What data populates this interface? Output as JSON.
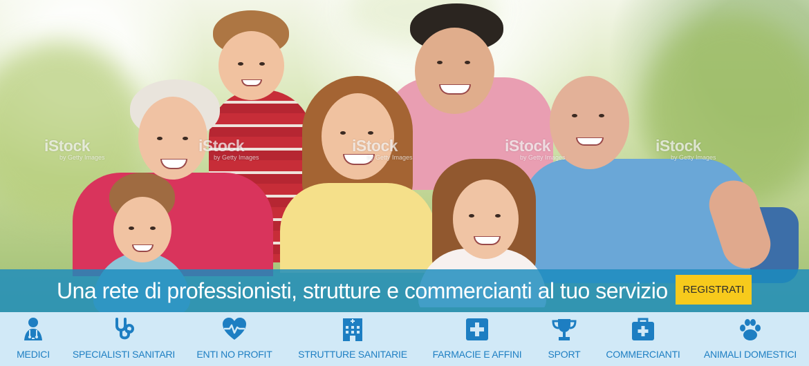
{
  "hero": {
    "watermark": {
      "brand": "iStock",
      "credit": "by Getty Images"
    }
  },
  "banner": {
    "title": "Una rete di professionisti, strutture e commercianti al tuo servizio",
    "register_label": "REGISTRATI"
  },
  "categories": [
    {
      "label": "MEDICI",
      "icon": "doctor-icon"
    },
    {
      "label": "SPECIALISTI SANITARI",
      "icon": "stethoscope-icon"
    },
    {
      "label": "ENTI NO PROFIT",
      "icon": "heartbeat-icon"
    },
    {
      "label": "STRUTTURE SANITARIE",
      "icon": "hospital-icon"
    },
    {
      "label": "FARMACIE E AFFINI",
      "icon": "pharmacy-cross-icon"
    },
    {
      "label": "SPORT",
      "icon": "trophy-icon"
    },
    {
      "label": "COMMERCIANTI",
      "icon": "medical-bag-icon"
    },
    {
      "label": "ANIMALI DOMESTICI",
      "icon": "paw-icon"
    }
  ],
  "colors": {
    "banner": "#1A8BBE",
    "button": "#F7CA1C",
    "category_bar": "#D1E9F7",
    "category_text": "#1D7EC2"
  }
}
